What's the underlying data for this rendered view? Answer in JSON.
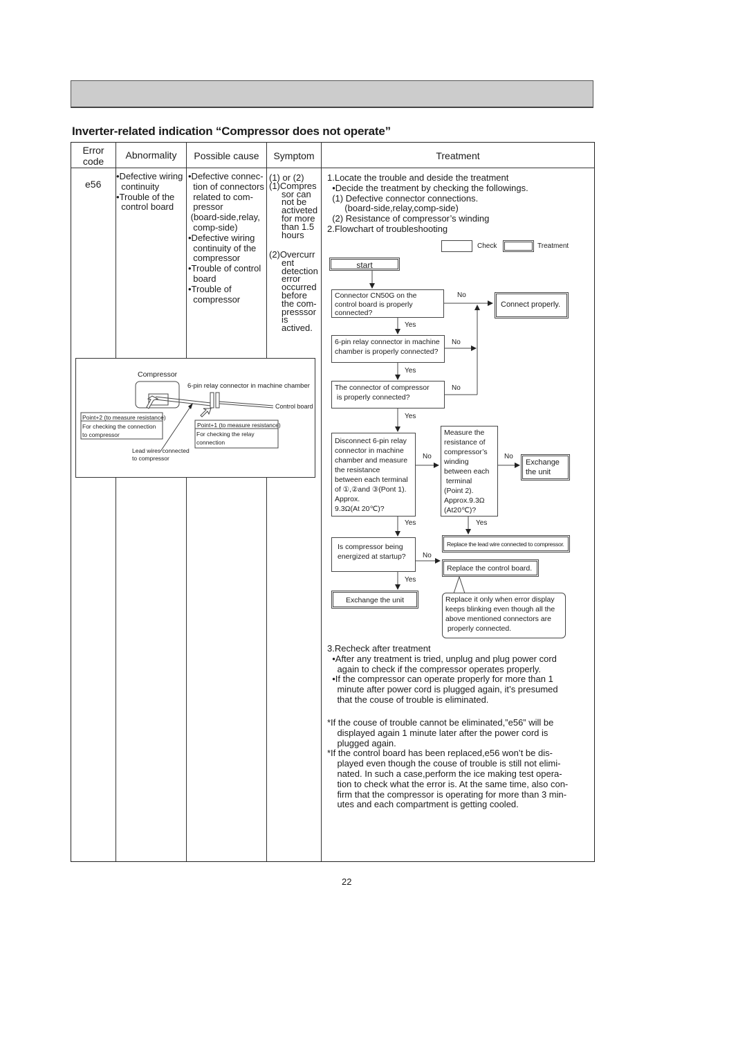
{
  "page": {
    "title": "Inverter-related indication “Compressor does not operate”",
    "page_number": "22"
  },
  "table": {
    "headers": {
      "error_code": "Error\ncode",
      "abnormality": "Abnormality",
      "possible_cause": "Possible cause",
      "symptom": "Symptom",
      "treatment": "Treatment"
    },
    "row": {
      "error_code": "e56",
      "abnormality": "•Defective wiring\n  continuity\n•Trouble of the\n  control board",
      "possible_cause": "•Defective connec-\n  tion of connectors\n  related to com-\n  pressor\n (board-side,relay,\n  comp-side)\n•Defective wiring\n  continuity of the\n  compressor\n•Trouble of control\n  board\n•Trouble of\n  compressor",
      "symptom_1": "(1) or (2)\n(1)Compres\n     sor can\n     not be\n     activeted\n     for more\n     than 1.5\n     hours",
      "symptom_2": "(2)Overcurr\n     ent\n     detection\n     error\n     occurred\n     before\n     the com-\n     presssor\n     is\n     actived."
    }
  },
  "diagram": {
    "compressor": "Compressor",
    "relay_connector": "6-pin relay connector in machine chamber",
    "control_board": "Control board",
    "point2_title": "Point+2 (to measure resistance)",
    "point2_desc": "For checking the connection\nto compressor",
    "point1_title": "Point+1 (to measure resistance)",
    "point1_desc": "For checking the relay\nconnection",
    "lead_wires": "Lead wires connected\nto compressor"
  },
  "treatment": {
    "intro": "1.Locate the trouble and deside the treatment\n  •Decide the treatment by checking the followings.\n  (1) Defective connector connections.\n       (board-side,relay,comp-side)\n  (2) Resistance of compressor’s winding\n2.Flowchart of troubleshooting",
    "legend_check": "Check",
    "legend_treatment": "Treatment",
    "recheck": "3.Recheck after treatment\n  •After any treatment is tried, unplug and plug power cord\n    again to check if the compressor operates properly.\n  •If the compressor can operate properly for more than 1\n    minute after power cord is plugged again, it’s presumed\n    that the couse of trouble is eliminated.",
    "notes": "*If the couse of trouble cannot be eliminated,”e56” will be\n    displayed again 1 minute later after the power cord is\n    plugged again.\n*If the control board has been replaced,e56 won’t be dis-\n    played even though the couse of trouble is still not elimi-\n    nated. In such a case,perform the ice making test opera-\n    tion to check what the error is. At the same time, also con-\n    firm that the compressor is operating for more than 3 min-\n    utes and each compartment is getting cooled."
  },
  "flowchart": {
    "start": "start",
    "q1": "Connector CN50G on the\ncontrol board is properly\nconnected?",
    "q2": "6-pin relay connector in machine\nchamber is properly connected?",
    "q3": "The connector of compressor\n is properly connected?",
    "q4": "Disconnect 6-pin relay\nconnector in machine\nchamber and measure\nthe resistance\nbetween each terminal\nof ①,②and ③(Pont 1).\nApprox.\n9.3Ω(At 20℃)?",
    "q5": "Measure the\nresistance of\ncompressor’s\nwinding\nbetween each\n terminal\n(Point 2).\nApprox.9.3Ω\n(At20℃)?",
    "q6": "Is compressor being\nenergized at startup?",
    "t_connect": "Connect properly.",
    "t_exchange_1": "Exchange\nthe unit",
    "t_replace_lead": "Replace the lead wire connected to compressor.",
    "t_replace_board": "Replace the control board.",
    "t_exchange_2": "Exchange the unit",
    "note": "Replace it only when error display\nkeeps blinking even though all the\nabove mentioned connectors are\n properly connected.",
    "yes": "Yes",
    "no": "No"
  }
}
